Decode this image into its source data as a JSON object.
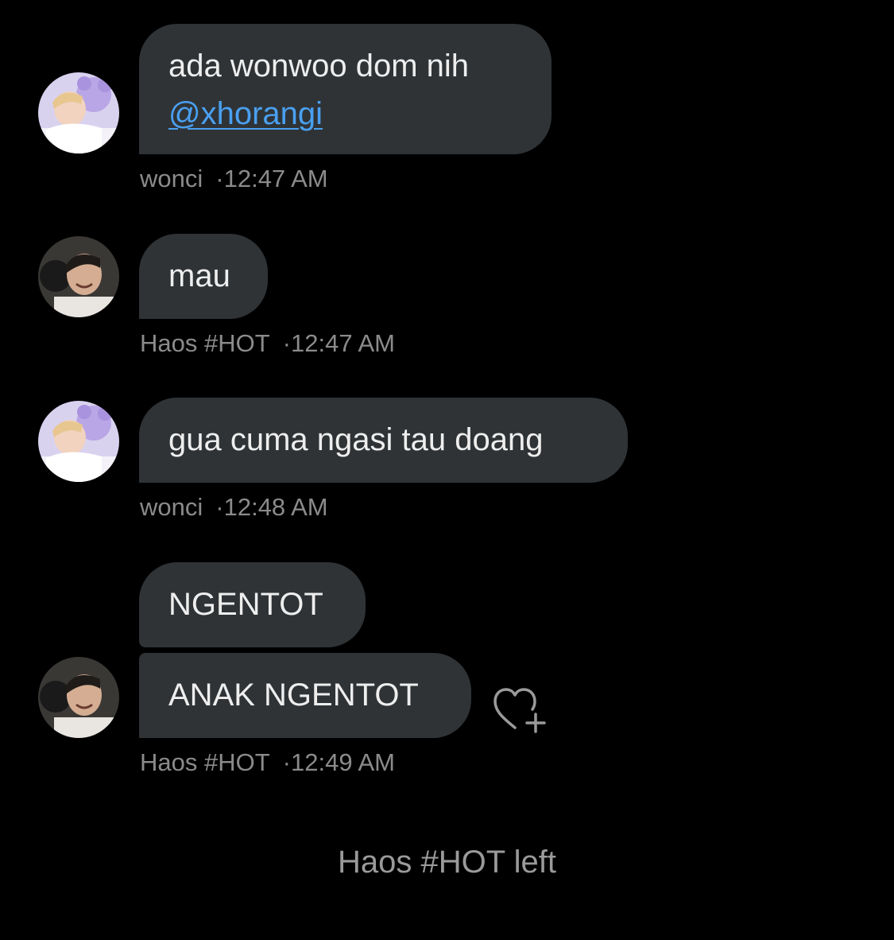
{
  "messages": [
    {
      "sender": "wonci",
      "text_line1": "ada wonwoo dom nih",
      "mention": "@xhorangi",
      "time": "12:47 AM",
      "avatar": "wonci-avatar"
    },
    {
      "sender": "Haos #HOT",
      "text": "mau",
      "time": "12:47 AM",
      "avatar": "haos-avatar"
    },
    {
      "sender": "wonci",
      "text": "gua cuma ngasi tau doang",
      "time": "12:48 AM",
      "avatar": "wonci-avatar"
    },
    {
      "sender": "Haos #HOT",
      "text_top": "NGENTOT",
      "text_bottom": "ANAK NGENTOT",
      "time": "12:49 AM",
      "avatar": "haos-avatar",
      "reaction_icon": "heart-plus-icon"
    }
  ],
  "meta_separator": "·",
  "system_message": "Haos #HOT left",
  "colors": {
    "background": "#000000",
    "bubble": "#2f3336",
    "mention": "#4aa0f0",
    "meta_text": "#8b8b8b"
  }
}
